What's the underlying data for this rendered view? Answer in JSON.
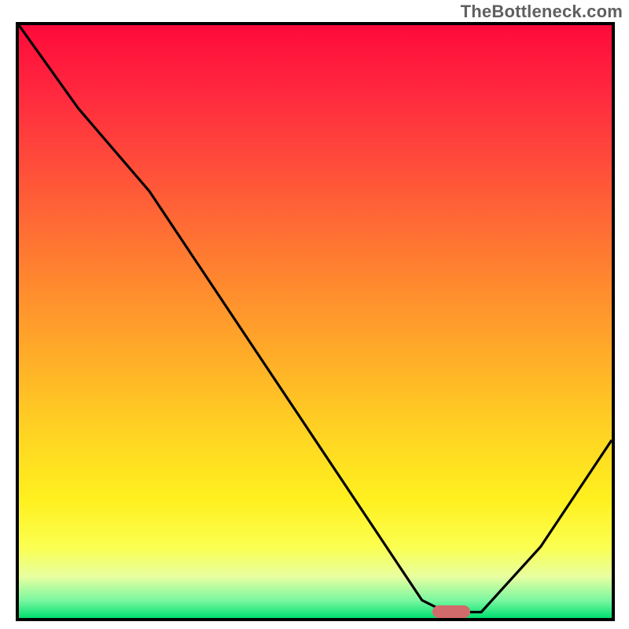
{
  "watermark": "TheBottleneck.com",
  "chart_data": {
    "type": "line",
    "title": "",
    "xlabel": "",
    "ylabel": "",
    "xlim": [
      0,
      100
    ],
    "ylim": [
      0,
      100
    ],
    "grid": false,
    "legend": false,
    "background": "red-yellow-green vertical gradient",
    "series": [
      {
        "name": "bottleneck-curve",
        "x": [
          0,
          10,
          22,
          30,
          40,
          50,
          60,
          68,
          72,
          78,
          88,
          100
        ],
        "y": [
          100,
          86,
          72,
          60,
          45,
          30,
          15,
          3,
          1,
          1,
          12,
          30
        ]
      }
    ],
    "annotations": [
      {
        "type": "marker",
        "shape": "pill",
        "color": "#d16a6a",
        "x_center": 73,
        "y_center": 1
      }
    ]
  },
  "colors": {
    "curve": "#000000",
    "marker": "#d16a6a",
    "border": "#000000"
  }
}
